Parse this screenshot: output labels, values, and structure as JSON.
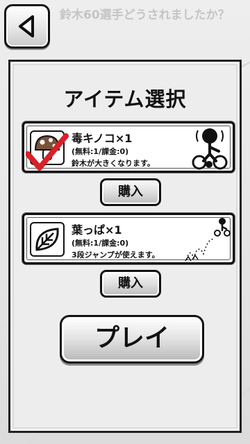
{
  "header": {
    "back_icon": "back-arrow-icon",
    "background_title": "鈴木60選手どうされましたか？"
  },
  "dialog": {
    "title": "アイテム選択",
    "items": [
      {
        "name": "毒キノコ×1",
        "count": "(無料:1/課金:0)",
        "description": "鈴木が大きくなります。",
        "icon": "mushroom-icon",
        "selected": true,
        "buy_label": "購入"
      },
      {
        "name": "葉っぱ×1",
        "count": "(無料:1/課金:0)",
        "description": "3段ジャンプが使えます。",
        "icon": "leaf-icon",
        "selected": false,
        "buy_label": "購入"
      }
    ],
    "play_label": "プレイ"
  },
  "colors": {
    "checkmark": "#d8202a",
    "mushroom_cap": "#7a5238",
    "background": "#e6e6e6"
  }
}
